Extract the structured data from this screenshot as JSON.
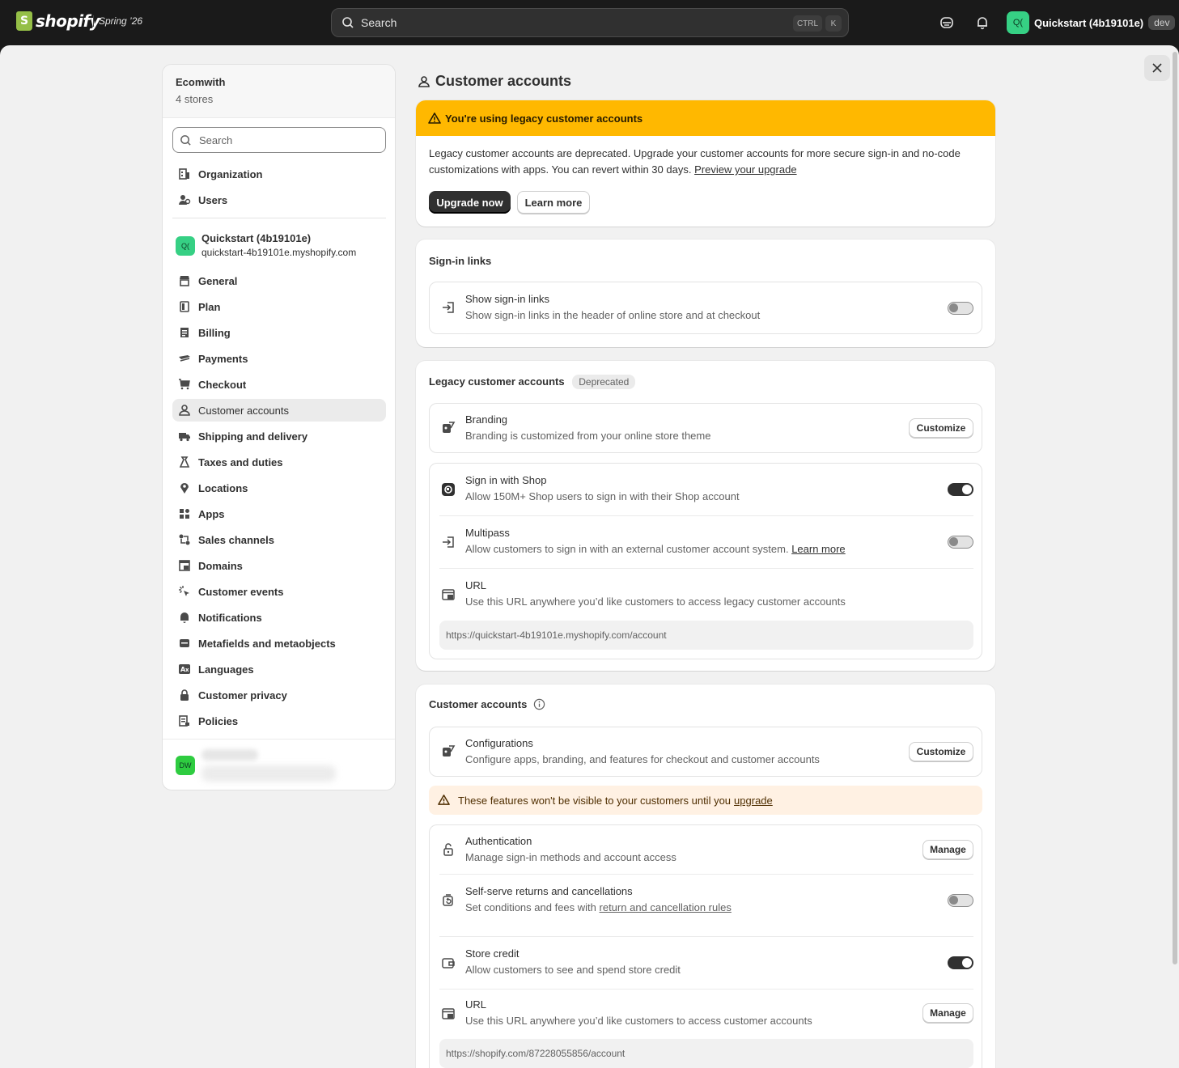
{
  "topbar": {
    "brand": "shopify",
    "edition": "Spring ’26",
    "search_placeholder": "Search",
    "shortcut_ctrl": "CTRL",
    "shortcut_k": "K",
    "store_avatar": "Q(",
    "store_name": "Quickstart (4b19101e)",
    "env_badge": "dev"
  },
  "sidebar": {
    "org_name": "Ecomwith",
    "store_count": "4 stores",
    "search_placeholder": "Search",
    "top_items": [
      {
        "label": "Organization",
        "icon": "organization-icon"
      },
      {
        "label": "Users",
        "icon": "users-icon"
      }
    ],
    "store": {
      "avatar": "Q(",
      "name": "Quickstart (4b19101e)",
      "domain": "quickstart-4b19101e.myshopify.com"
    },
    "items": [
      {
        "label": "General",
        "icon": "store-icon"
      },
      {
        "label": "Plan",
        "icon": "plan-icon"
      },
      {
        "label": "Billing",
        "icon": "billing-icon"
      },
      {
        "label": "Payments",
        "icon": "payments-icon"
      },
      {
        "label": "Checkout",
        "icon": "cart-icon"
      },
      {
        "label": "Customer accounts",
        "icon": "person-icon",
        "active": true
      },
      {
        "label": "Shipping and delivery",
        "icon": "truck-icon"
      },
      {
        "label": "Taxes and duties",
        "icon": "tax-icon"
      },
      {
        "label": "Locations",
        "icon": "location-icon"
      },
      {
        "label": "Apps",
        "icon": "apps-icon"
      },
      {
        "label": "Sales channels",
        "icon": "sales-channels-icon"
      },
      {
        "label": "Domains",
        "icon": "domains-icon"
      },
      {
        "label": "Customer events",
        "icon": "cursor-icon"
      },
      {
        "label": "Notifications",
        "icon": "bell-icon"
      },
      {
        "label": "Metafields and metaobjects",
        "icon": "metafields-icon"
      },
      {
        "label": "Languages",
        "icon": "language-icon"
      },
      {
        "label": "Customer privacy",
        "icon": "lock-icon"
      },
      {
        "label": "Policies",
        "icon": "policies-icon"
      }
    ],
    "footer_avatar": "DW"
  },
  "page": {
    "title": "Customer accounts"
  },
  "legacy_banner": {
    "title": "You're using legacy customer accounts",
    "body": "Legacy customer accounts are deprecated. Upgrade your customer accounts for more secure sign-in and no-code customizations with apps. You can revert within 30 days.",
    "link": "Preview your upgrade",
    "primary": "Upgrade now",
    "secondary": "Learn more"
  },
  "signin_links": {
    "title": "Sign-in links",
    "row_title": "Show sign-in links",
    "row_desc": "Show sign-in links in the header of online store and at checkout",
    "enabled": false
  },
  "legacy_accounts": {
    "title": "Legacy customer accounts",
    "badge": "Deprecated",
    "branding_title": "Branding",
    "branding_desc": "Branding is customized from your online store theme",
    "customize": "Customize",
    "shop_title": "Sign in with Shop",
    "shop_desc": "Allow 150M+ Shop users to sign in with their Shop account",
    "shop_enabled": true,
    "multipass_title": "Multipass",
    "multipass_desc": "Allow customers to sign in with an external customer account system.",
    "multipass_link": "Learn more",
    "multipass_enabled": false,
    "url_title": "URL",
    "url_desc": "Use this URL anywhere you’d like customers to access legacy customer accounts",
    "url_value": "https://quickstart-4b19101e.myshopify.com/account"
  },
  "customer_accounts": {
    "title": "Customer accounts",
    "config_title": "Configurations",
    "config_desc": "Configure apps, branding, and features for checkout and customer accounts",
    "customize": "Customize",
    "notice": "These features won't be visible to your customers until you",
    "notice_link": "upgrade",
    "auth_title": "Authentication",
    "auth_desc": "Manage sign-in methods and account access",
    "manage": "Manage",
    "returns_title": "Self-serve returns and cancellations",
    "returns_desc": "Set conditions and fees with",
    "returns_link": "return and cancellation rules",
    "returns_enabled": false,
    "credit_title": "Store credit",
    "credit_desc": "Allow customers to see and spend store credit",
    "credit_enabled": true,
    "url_title": "URL",
    "url_desc": "Use this URL anywhere you’d like customers to access customer accounts",
    "url_manage": "Manage",
    "url_value": "https://shopify.com/87228055856/account"
  }
}
